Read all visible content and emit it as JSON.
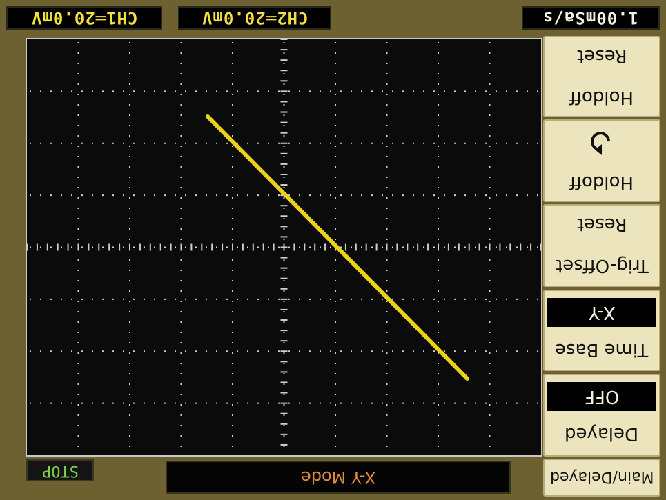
{
  "header": {
    "ch1_label": "CH1═20.0mV",
    "ch2_label": "CH2═20.0mV",
    "timebase_label": "1.00mSa/s"
  },
  "softkeys": {
    "reset_holdoff_top": "Reset",
    "reset_holdoff_bottom": "Holdoff",
    "holdoff_icon": "rotate-arrow-icon",
    "holdoff_label": "Holdoff",
    "reset_trig_top": "Reset",
    "reset_trig_bottom": "Trig-Offset",
    "timebase_value": "X-Y",
    "timebase_label": "Time Base",
    "delayed_value": "OFF",
    "delayed_label": "Delayed",
    "main_delayed_label": "Main/Delayed"
  },
  "status": {
    "run_state": "STOP",
    "mode_text": "X-Y Mode"
  },
  "colors": {
    "bezel": "#6d6031",
    "trace": "#e8d21a",
    "grid_dots": "#cfcfcf",
    "softkey_bg": "#ebe4bd",
    "status_text": "#e08c3b",
    "stop_text": "#7bd14b"
  }
}
